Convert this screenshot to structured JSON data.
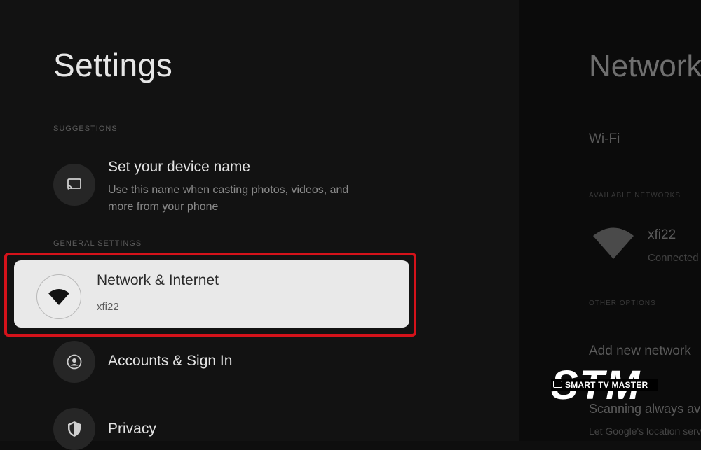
{
  "settings": {
    "title": "Settings",
    "suggestions_label": "SUGGESTIONS",
    "suggestion": {
      "title": "Set your device name",
      "description": "Use this name when casting photos, videos, and more from your phone",
      "icon": "cast-icon"
    },
    "general_label": "GENERAL SETTINGS",
    "items": [
      {
        "title": "Network & Internet",
        "subtitle": "xfi22",
        "icon": "wifi-icon",
        "selected": true
      },
      {
        "title": "Accounts & Sign In",
        "icon": "account-icon"
      },
      {
        "title": "Privacy",
        "icon": "shield-icon"
      }
    ]
  },
  "network_panel": {
    "title": "Network",
    "wifi_label": "Wi-Fi",
    "available_label": "AVAILABLE NETWORKS",
    "network": {
      "name": "xfi22",
      "status": "Connected"
    },
    "other_label": "OTHER OPTIONS",
    "add_network": "Add new network",
    "scanning": "Scanning always available",
    "scanning_desc": "Let Google's location service..."
  },
  "watermark": {
    "big": "STM",
    "small": "SMART TV MASTER"
  },
  "colors": {
    "highlight": "#d4121a",
    "selected_bg": "#e9e9e9",
    "background": "#121212"
  }
}
